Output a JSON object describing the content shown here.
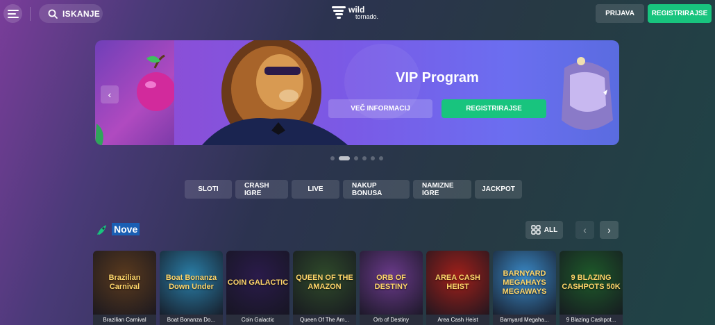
{
  "header": {
    "search_label": "ISKANJE",
    "logo_line1": "wild",
    "logo_line2": "tornado.",
    "login_label": "PRIJAVA",
    "register_label": "REGISTRIRAJSE"
  },
  "banner": {
    "title": "VIP Program",
    "info_label": "VEČ INFORMACIJ",
    "register_label": "REGISTRIRAJSE",
    "slide_count": 6,
    "active_slide": 2
  },
  "categories": [
    "SLOTI",
    "CRASH IGRE",
    "LIVE",
    "NAKUP BONUSA",
    "NAMIZNE IGRE",
    "JACKPOT"
  ],
  "section": {
    "title": "Nove",
    "all_label": "ALL"
  },
  "games": [
    {
      "name": "Brazilian Carnival",
      "art": "Brazilian Carnival",
      "color": "#5a3a1e"
    },
    {
      "name": "Boat Bonanza Do...",
      "art": "Boat Bonanza Down Under",
      "color": "#2a7fa8"
    },
    {
      "name": "Coin Galactic",
      "art": "COIN GALACTIC",
      "color": "#2a1b4a"
    },
    {
      "name": "Queen Of The Am...",
      "art": "QUEEN OF THE AMAZON",
      "color": "#2f4a2a"
    },
    {
      "name": "Orb of Destiny",
      "art": "ORB OF DESTINY",
      "color": "#6a3a8a"
    },
    {
      "name": "Area Cash Heist",
      "art": "AREA CASH HEIST",
      "color": "#a0201a"
    },
    {
      "name": "Barnyard Megaha...",
      "art": "BARNYARD MEGAHAYS MEGAWAYS",
      "color": "#3a8ac8"
    },
    {
      "name": "9 Blazing Cashpot...",
      "art": "9 BLAZING CASHPOTS 50K",
      "color": "#1e5a2a"
    }
  ],
  "colors": {
    "accent": "#18c47e",
    "section_highlight": "#1a5fb4"
  }
}
